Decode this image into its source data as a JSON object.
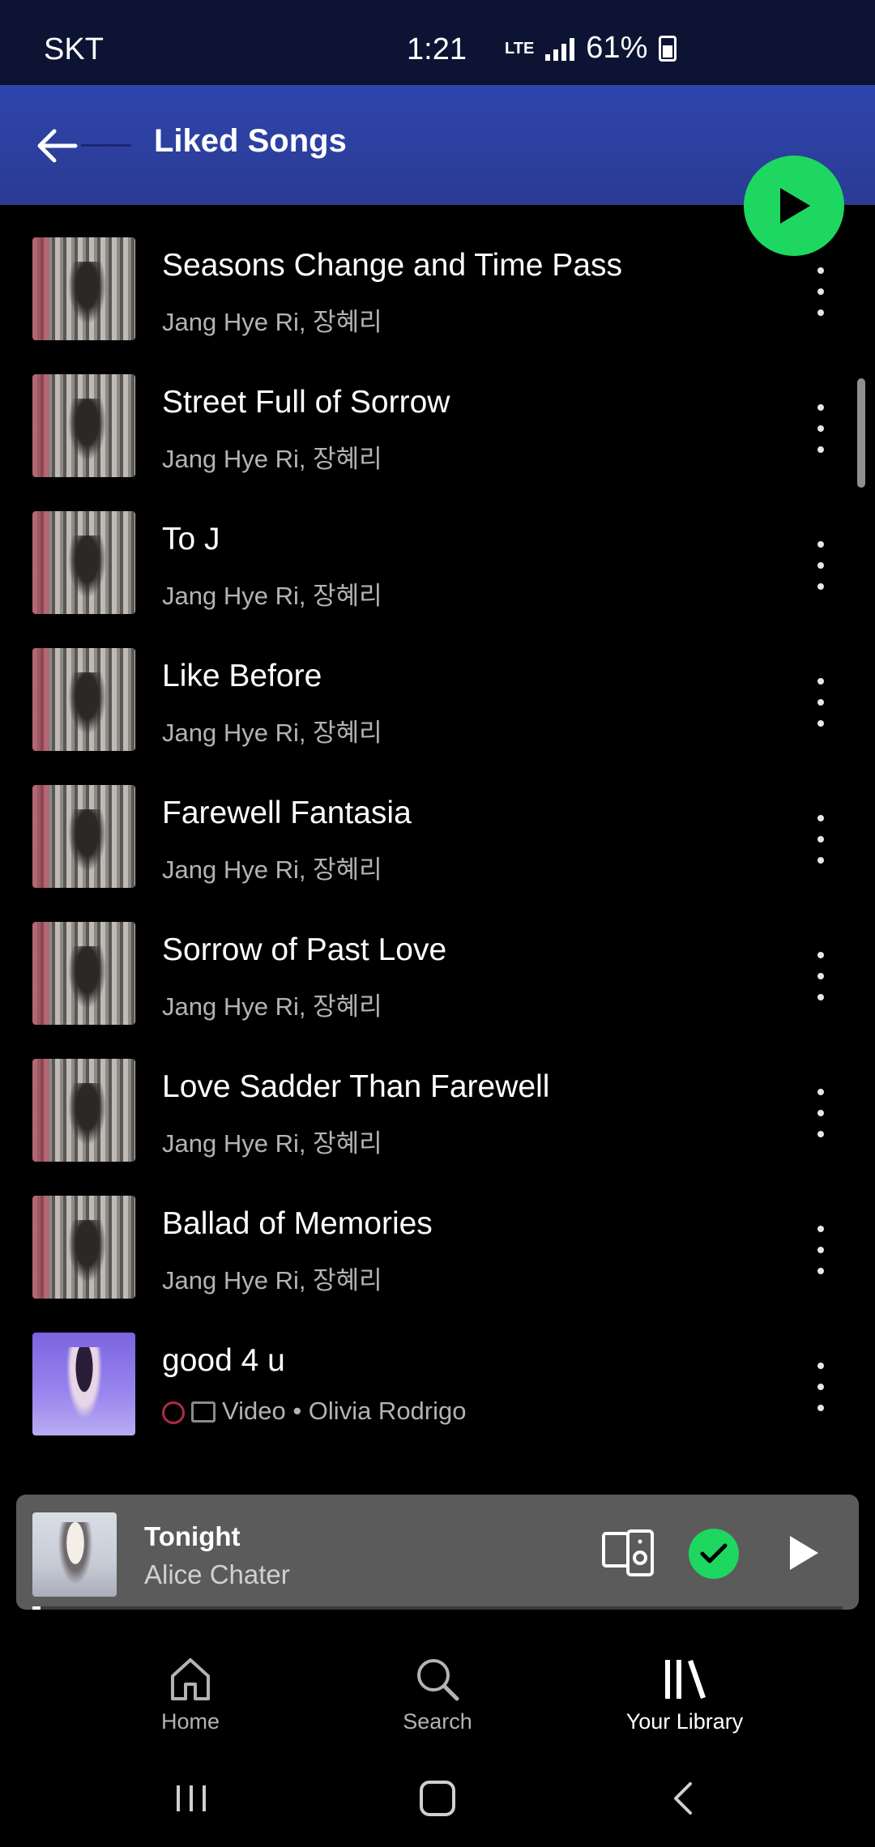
{
  "status_bar": {
    "carrier": "SKT",
    "time": "1:21",
    "network": "LTE",
    "battery": "61%"
  },
  "header": {
    "title": "Liked Songs"
  },
  "songs": [
    {
      "title": "Seasons Change and Time Pass",
      "artist": "Jang Hye Ri, 장혜리",
      "art": "album-jang-hye-ri"
    },
    {
      "title": "Street Full of Sorrow",
      "artist": "Jang Hye Ri, 장혜리",
      "art": "album-jang-hye-ri"
    },
    {
      "title": "To J",
      "artist": "Jang Hye Ri, 장혜리",
      "art": "album-jang-hye-ri"
    },
    {
      "title": "Like Before",
      "artist": "Jang Hye Ri, 장혜리",
      "art": "album-jang-hye-ri"
    },
    {
      "title": "Farewell Fantasia",
      "artist": "Jang Hye Ri, 장혜리",
      "art": "album-jang-hye-ri"
    },
    {
      "title": "Sorrow of Past Love",
      "artist": "Jang Hye Ri, 장혜리",
      "art": "album-jang-hye-ri"
    },
    {
      "title": "Love Sadder Than Farewell",
      "artist": "Jang Hye Ri, 장혜리",
      "art": "album-jang-hye-ri"
    },
    {
      "title": "Ballad of Memories",
      "artist": "Jang Hye Ri, 장혜리",
      "art": "album-jang-hye-ri"
    },
    {
      "title": "good 4 u",
      "artist": "Video • Olivia Rodrigo",
      "art": "album-olivia-rodrigo"
    }
  ],
  "mini_player": {
    "title": "Tonight",
    "artist": "Alice Chater",
    "liked": true,
    "progress": 0.01
  },
  "bottom_nav": [
    {
      "label": "Home",
      "icon": "home-icon",
      "active": false
    },
    {
      "label": "Search",
      "icon": "search-icon",
      "active": false
    },
    {
      "label": "Your Library",
      "icon": "library-icon",
      "active": true
    }
  ],
  "colors": {
    "accent": "#1ed760",
    "header": "#2f45ad",
    "background": "#000000",
    "mini_player": "#5b5b5b"
  }
}
